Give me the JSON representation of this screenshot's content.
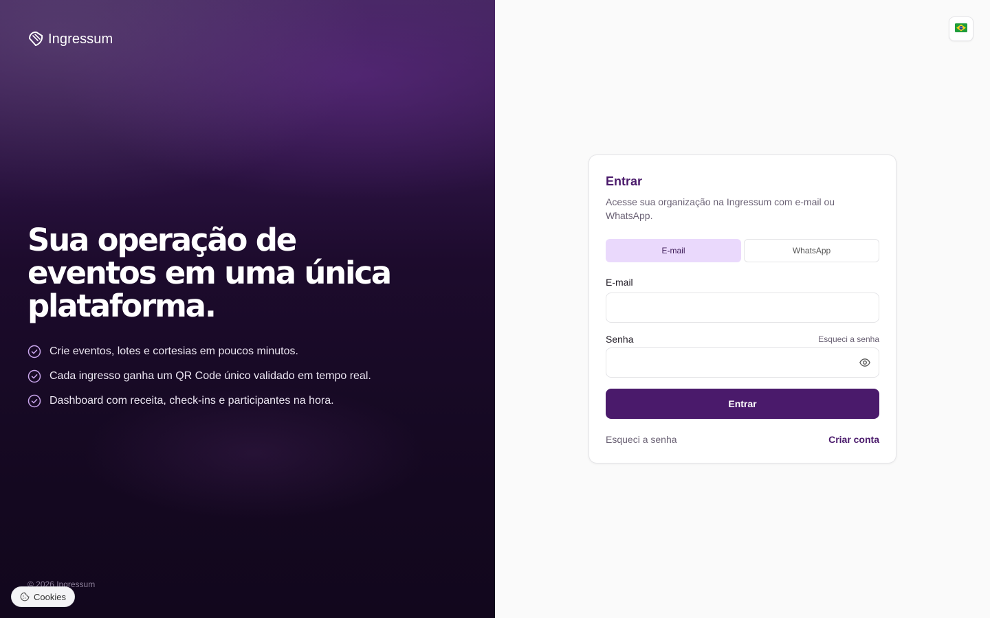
{
  "brand": {
    "name": "Ingressum"
  },
  "hero": {
    "headline": "Sua operação de eventos em uma única plataforma.",
    "features": [
      "Crie eventos, lotes e cortesias em poucos minutos.",
      "Cada ingresso ganha um QR Code único validado em tempo real.",
      "Dashboard com receita, check-ins e participantes na hora."
    ],
    "copyright": "© 2026 Ingressum"
  },
  "cookies": {
    "label": "Cookies"
  },
  "language": {
    "flag": "🇧🇷"
  },
  "login": {
    "title": "Entrar",
    "description": "Acesse sua organização na Ingressum com e-mail ou WhatsApp.",
    "tabs": [
      {
        "label": "E-mail",
        "active": true
      },
      {
        "label": "WhatsApp",
        "active": false
      }
    ],
    "email_label": "E-mail",
    "email_value": "",
    "password_label": "Senha",
    "password_value": "",
    "forgot_small": "Esqueci a senha",
    "submit_label": "Entrar",
    "forgot_footer": "Esqueci a senha",
    "create_account": "Criar conta"
  },
  "colors": {
    "accent": "#4a1a6b",
    "tab_active_bg": "#ead9fc",
    "hero_bg": "#1d0b2d"
  },
  "icons": [
    "logo-icon",
    "check-circle-icon",
    "cookie-icon",
    "eye-icon",
    "brazil-flag-icon"
  ]
}
